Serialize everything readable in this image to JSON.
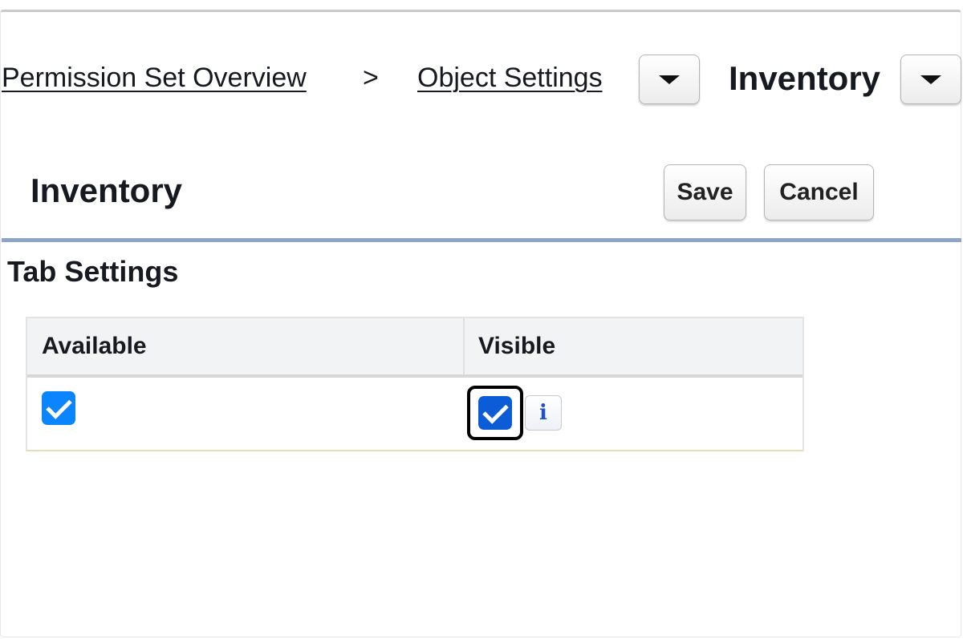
{
  "breadcrumb": {
    "overview_link": "Permission Set Overview",
    "separator": ">",
    "object_settings_link": "Object Settings",
    "current": "Inventory"
  },
  "header": {
    "title": "Inventory",
    "save_label": "Save",
    "cancel_label": "Cancel"
  },
  "tab_settings": {
    "section_title": "Tab Settings",
    "columns": [
      "Available",
      "Visible"
    ],
    "row": {
      "available_checked": true,
      "visible_checked": true
    },
    "info_glyph": "i"
  },
  "icons": {
    "dropdown": "chevron-down-icon",
    "info": "info-icon",
    "check": "check-icon"
  },
  "colors": {
    "checkbox_blue": "#0a84ff",
    "checkbox_focused": "#0b5cd6",
    "divider": "#8ea5c8",
    "info_icon": "#1a4fd6"
  }
}
